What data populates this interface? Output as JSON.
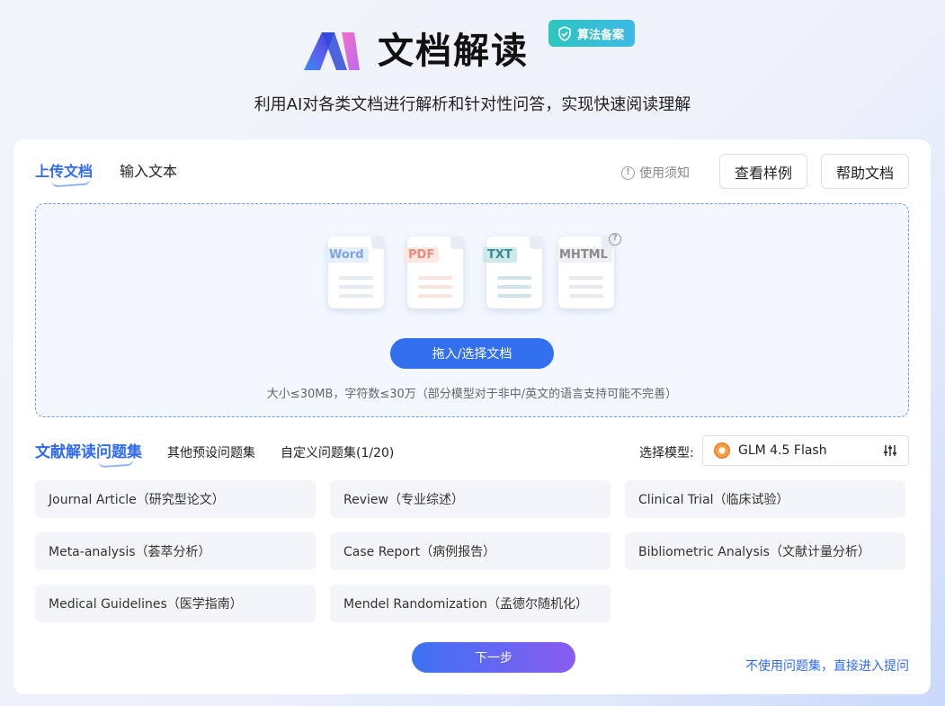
{
  "header": {
    "title": "文档解读",
    "badge": "算法备案",
    "subtitle": "利用AI对各类文档进行解析和针对性问答，实现快速阅读理解"
  },
  "upload": {
    "tabs": [
      "上传文档",
      "输入文本"
    ],
    "notice": "使用须知",
    "sample_button": "查看样例",
    "help_button": "帮助文档",
    "file_types": [
      "Word",
      "PDF",
      "TXT",
      "MHTML"
    ],
    "upload_button": "拖入/选择文档",
    "hint": "大小≤30MB，字符数≤30万（部分模型对于非中/英文的语言支持可能不完善）"
  },
  "questions": {
    "tabs": [
      "文献解读问题集",
      "其他预设问题集",
      "自定义问题集(1/20)"
    ],
    "model_label": "选择模型:",
    "model_name": "GLM 4.5 Flash",
    "items": [
      "Journal Article（研究型论文）",
      "Review（专业综述）",
      "Clinical Trial（临床试验）",
      "Meta-analysis（荟萃分析）",
      "Case Report（病例报告）",
      "Bibliometric Analysis（文献计量分析）",
      "Medical Guidelines（医学指南）",
      "Mendel Randomization（孟德尔随机化）"
    ],
    "next_button": "下一步",
    "skip_link": "不使用问题集，直接进入提问"
  },
  "colors": {
    "accent": "#2f6bf0",
    "badge": "#2dc6c0",
    "next_gradient_end": "#8a5cf1"
  }
}
